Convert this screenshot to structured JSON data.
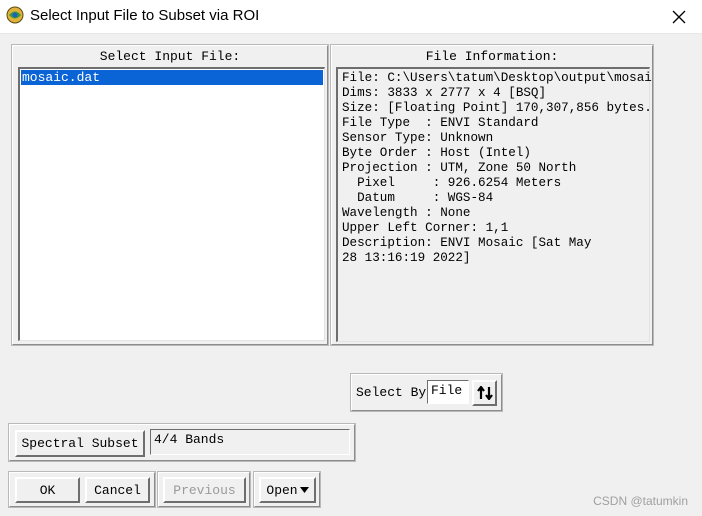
{
  "window": {
    "title": "Select Input File to Subset via ROI"
  },
  "input_panel": {
    "label": "Select Input File:",
    "files": [
      "mosaic.dat"
    ]
  },
  "info_panel": {
    "label": "File Information:",
    "lines": [
      "File: C:\\Users\\tatum\\Desktop\\output\\mosai",
      "Dims: 3833 x 2777 x 4 [BSQ]",
      "Size: [Floating Point] 170,307,856 bytes.",
      "File Type  : ENVI Standard",
      "Sensor Type: Unknown",
      "Byte Order : Host (Intel)",
      "Projection : UTM, Zone 50 North",
      "  Pixel     : 926.6254 Meters",
      "  Datum     : WGS-84",
      "Wavelength : None",
      "Upper Left Corner: 1,1",
      "Description: ENVI Mosaic [Sat May",
      "28 13:16:19 2022]"
    ]
  },
  "select_by": {
    "label": "Select By",
    "value": "File"
  },
  "spectral_subset": {
    "button_label": "Spectral Subset",
    "value": "4/4 Bands"
  },
  "buttons": {
    "ok": "OK",
    "cancel": "Cancel",
    "previous": "Previous",
    "open": "Open"
  },
  "watermark": "CSDN @tatumkin",
  "icons": {
    "app": "envi-globe-icon",
    "close": "close-icon",
    "sort": "sort-arrows-icon",
    "dropdown": "caret-down-icon"
  }
}
